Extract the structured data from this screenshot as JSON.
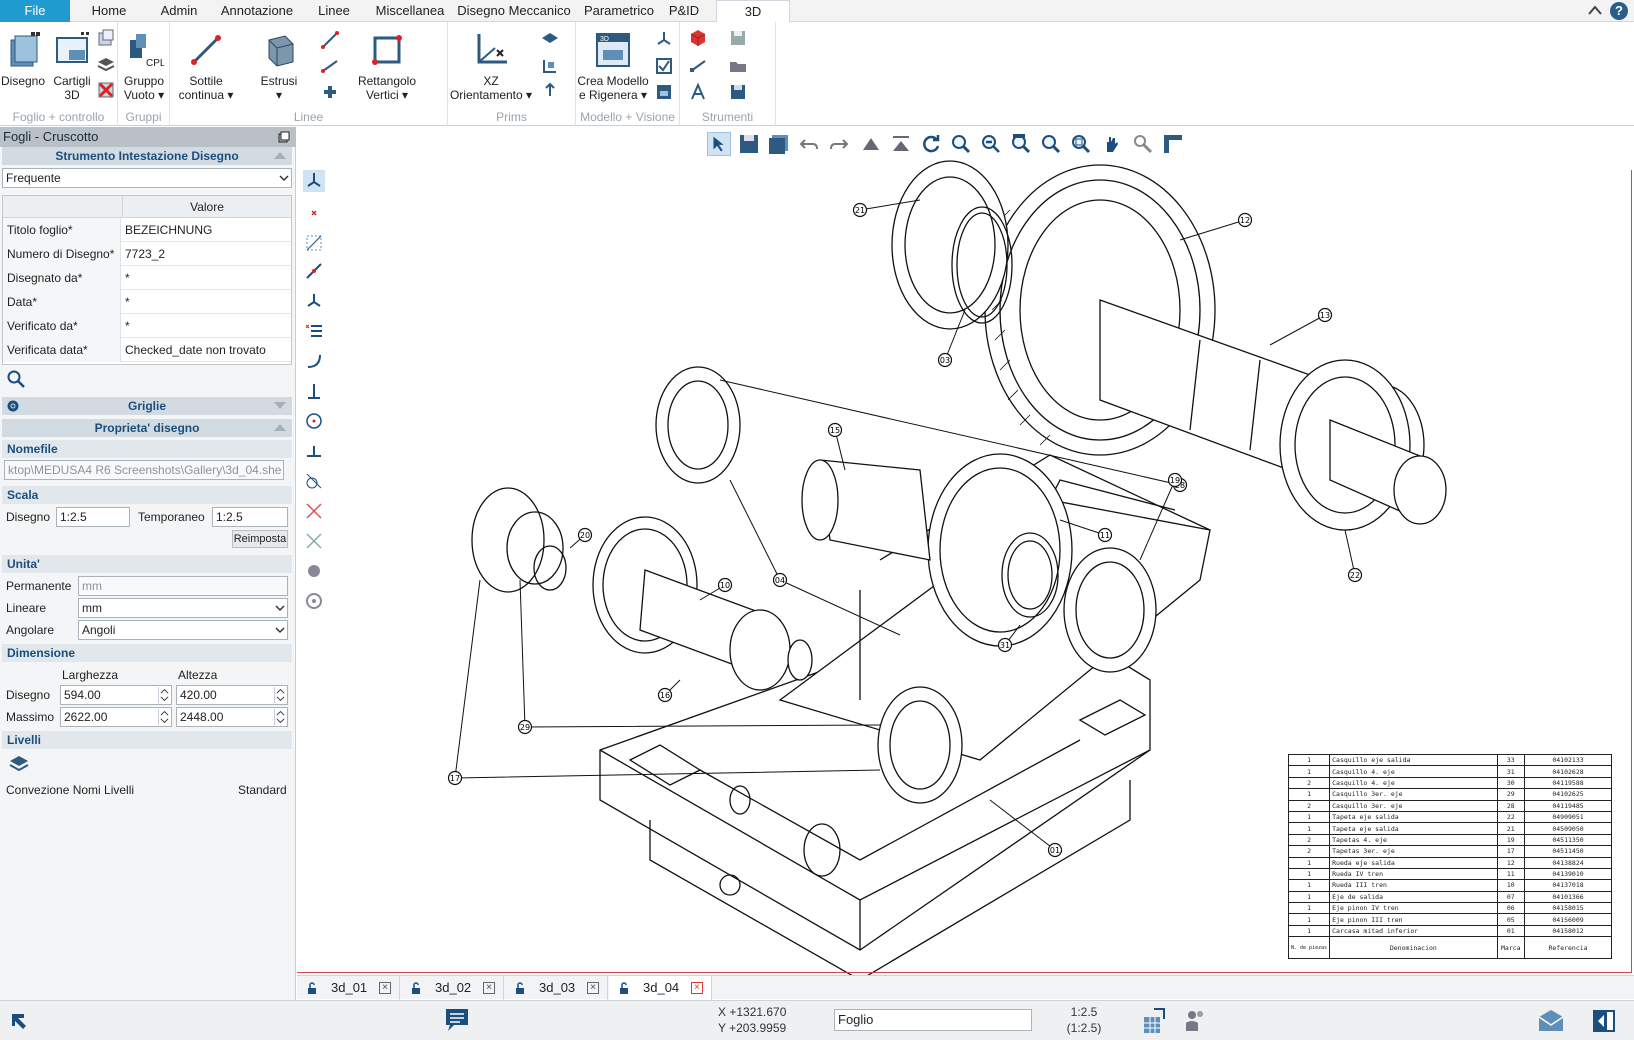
{
  "ribbon": {
    "tabs": [
      "File",
      "Home",
      "Admin",
      "Annotazione",
      "Linee",
      "Miscellanea",
      "Disegno Meccanico",
      "Parametrico",
      "P&ID",
      "3D"
    ],
    "active_tab": "3D",
    "groups": {
      "foglio": {
        "label": "Foglio + controllo",
        "disegno": "Disegno",
        "cartigli_line1": "Cartigli",
        "cartigli_line2": "3D"
      },
      "gruppi": {
        "label": "Gruppi",
        "gruppo_line1": "Gruppo",
        "gruppo_line2": "Vuoto",
        "cpl": "CPL"
      },
      "linee": {
        "label": "Linee",
        "sottile_line1": "Sottile",
        "sottile_line2": "continua",
        "estrusi": "Estrusi",
        "rett_line1": "Rettangolo",
        "rett_line2": "Vertici"
      },
      "prims": {
        "label": "Prims",
        "xz_line1": "XZ",
        "xz_line2": "Orientamento"
      },
      "modello": {
        "label": "Modello + Visione",
        "crea_line1": "Crea Modello",
        "crea_line2": "e Rigenera",
        "icon_3d": "3D"
      },
      "strumenti": {
        "label": "Strumenti"
      }
    }
  },
  "left_panel": {
    "title": "Fogli - Cruscotto",
    "section_intestazione": "Strumento Intestazione Disegno",
    "filter_value": "Frequente",
    "table_header": "Valore",
    "properties": [
      {
        "key": "Titolo foglio*",
        "value": "BEZEICHNUNG"
      },
      {
        "key": "Numero di Disegno*",
        "value": "7723_2"
      },
      {
        "key": "Disegnato da*",
        "value": "*"
      },
      {
        "key": "Data*",
        "value": "*"
      },
      {
        "key": "Verificato da*",
        "value": "*"
      },
      {
        "key": "Verificata data*",
        "value": "Checked_date non trovato"
      }
    ],
    "section_griglie": "Griglie",
    "section_proprieta": "Proprieta' disegno",
    "nomefile_label": "Nomefile",
    "nomefile_value": "ktop\\MEDUSA4 R6 Screenshots\\Gallery\\3d_04.she",
    "scala_label": "Scala",
    "scala_disegno_label": "Disegno",
    "scala_disegno_value": "1:2.5",
    "scala_temp_label": "Temporaneo",
    "scala_temp_value": "1:2.5",
    "reimposta": "Reimposta",
    "unita_label": "Unita'",
    "permanente_label": "Permanente",
    "permanente_value": "mm",
    "lineare_label": "Lineare",
    "lineare_value": "mm",
    "angolare_label": "Angolare",
    "angolare_value": "Angoli",
    "dimensione_label": "Dimensione",
    "larghezza_label": "Larghezza",
    "altezza_label": "Altezza",
    "dim_disegno_label": "Disegno",
    "dim_disegno_w": "594.00",
    "dim_disegno_h": "420.00",
    "dim_massimo_label": "Massimo",
    "dim_massimo_w": "2622.00",
    "dim_massimo_h": "2448.00",
    "livelli_label": "Livelli",
    "convenzione_label": "Convezione Nomi Livelli",
    "convenzione_value": "Standard"
  },
  "sheet_tabs": [
    "3d_01",
    "3d_02",
    "3d_03",
    "3d_04"
  ],
  "active_sheet": "3d_04",
  "status": {
    "coord_x": "X +1321.670",
    "coord_y": "Y +203.9959",
    "mode_value": "Foglio",
    "scale_line1": "1:2.5",
    "scale_line2": "(1:2.5)"
  },
  "callouts": [
    "21",
    "12",
    "13",
    "03",
    "28",
    "15",
    "19",
    "11",
    "10",
    "04",
    "20",
    "31",
    "16",
    "29",
    "17",
    "22",
    "01"
  ],
  "bom": {
    "rows": [
      [
        "1",
        "Casquillo eje salida",
        "33",
        "04102133"
      ],
      [
        "1",
        "Casquillo 4. eje",
        "31",
        "04102628"
      ],
      [
        "2",
        "Casquillo 4. eje",
        "30",
        "04119588"
      ],
      [
        "1",
        "Casquillo 3er. eje",
        "29",
        "04102625"
      ],
      [
        "2",
        "Casquillo 3er. eje",
        "28",
        "04119485"
      ],
      [
        "1",
        "Tapeta eje salida",
        "22",
        "04909051"
      ],
      [
        "1",
        "Tapeta eje salida",
        "21",
        "04509050"
      ],
      [
        "2",
        "Tapetas 4. eje",
        "19",
        "04511350"
      ],
      [
        "2",
        "Tapetas 3er. eje",
        "17",
        "04511450"
      ],
      [
        "1",
        "Rueda eje salida",
        "12",
        "04138824"
      ],
      [
        "1",
        "Rueda IV tren",
        "11",
        "04139010"
      ],
      [
        "1",
        "Rueda III tren",
        "10",
        "04137018"
      ],
      [
        "1",
        "Eje de salida",
        "07",
        "04101366"
      ],
      [
        "1",
        "Eje pinon IV tren",
        "06",
        "04158015"
      ],
      [
        "1",
        "Eje pinon III tren",
        "05",
        "04156009"
      ],
      [
        "1",
        "Carcasa mitad inferior",
        "01",
        "04158012"
      ]
    ],
    "header": [
      "N. de piezas",
      "Denominacion",
      "Marca",
      "Referencia"
    ]
  }
}
